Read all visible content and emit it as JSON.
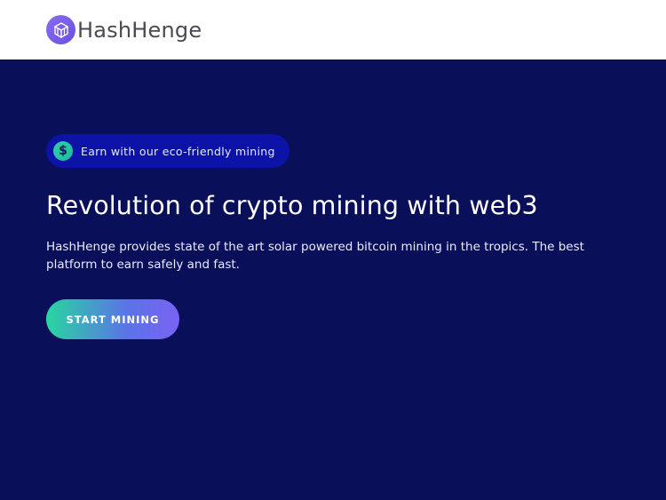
{
  "header": {
    "brand": "HashHenge",
    "logo_icon": "cube-stack-icon",
    "logo_color": "#7b5cf0"
  },
  "hero": {
    "badge": {
      "icon": "dollar-icon",
      "icon_glyph": "$",
      "text": "Earn with our eco-friendly mining"
    },
    "title": "Revolution of crypto mining with web3",
    "description": "HashHenge provides state of the art solar powered bitcoin mining in the tropics. The best platform to earn safely and fast.",
    "cta_label": "START MINING"
  },
  "colors": {
    "background": "#0a0f5a",
    "badge_bg": "#0c13a6",
    "cta_start": "#28d6a0",
    "cta_end": "#7a62f4"
  }
}
